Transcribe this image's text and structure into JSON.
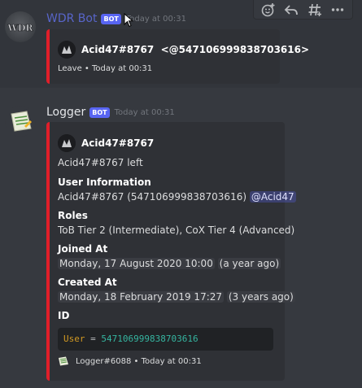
{
  "message1": {
    "username": "WDR Bot",
    "bot_tag": "BOT",
    "timestamp": "Today at 00:31",
    "embed": {
      "author": "Acid47#8767",
      "author_id": "<@547106999838703616>",
      "footer": "Leave • Today at 00:31"
    }
  },
  "message2": {
    "username": "Logger",
    "bot_tag": "BOT",
    "timestamp": "Today at 00:31",
    "embed": {
      "author": "Acid47#8767",
      "description": "Acid47#8767 left",
      "fields": [
        {
          "name": "User Information",
          "value": "Acid47#8767 (547106999838703616)",
          "mention": "@Acid47"
        },
        {
          "name": "Roles",
          "value": "ToB Tier 2 (Intermediate), CoX Tier 4 (Advanced)"
        },
        {
          "name": "Joined At",
          "value": "Monday, 17 August 2020 10:00",
          "relative": "a year ago"
        },
        {
          "name": "Created At",
          "value": "Monday, 18 February 2019 17:27",
          "relative": "3 years ago"
        },
        {
          "name": "ID",
          "code_key": "User",
          "code_eq": "=",
          "code_val": "547106999838703616"
        }
      ],
      "footer_author": "Logger#6088",
      "footer_time": "Today at 00:31"
    }
  },
  "toolbar": {
    "icons": [
      "add-reaction-icon",
      "reply-icon",
      "create-thread-icon",
      "more-icon"
    ]
  },
  "colors": {
    "background": "#36393f",
    "embed_bg": "#2f3136",
    "embed_border": "#e01e2a",
    "bot_badge": "#5865f2",
    "wdr_name": "#5865c9"
  }
}
